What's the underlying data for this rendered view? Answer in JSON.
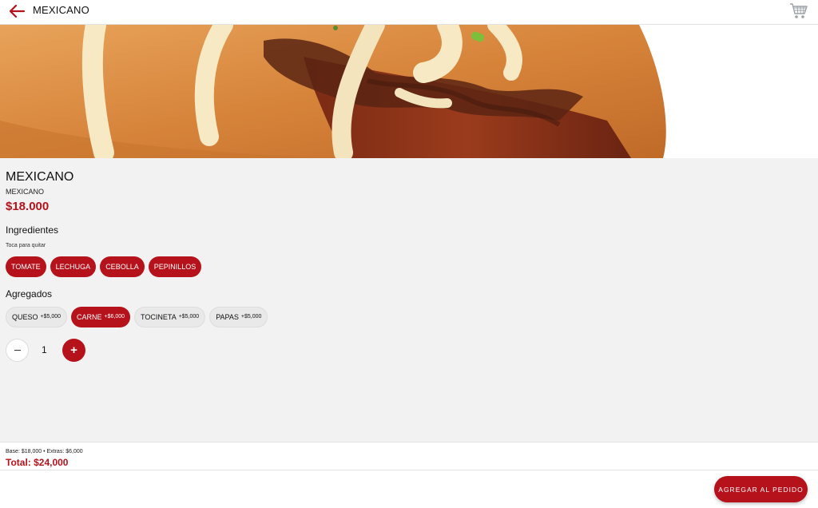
{
  "header": {
    "title": "MEXICANO",
    "back_icon": "arrow-left-icon",
    "cart_icon": "shopping-cart-icon"
  },
  "hero": {
    "image": "hot-dog-photo"
  },
  "product": {
    "name": "MEXICANO",
    "subtitle": "MEXICANO",
    "price": "$18.000"
  },
  "ingredients": {
    "title": "Ingredientes",
    "hint": "Toca para quitar",
    "items": [
      {
        "label": "TOMATE",
        "selected": true
      },
      {
        "label": "LECHUGA",
        "selected": true
      },
      {
        "label": "CEBOLLA",
        "selected": true
      },
      {
        "label": "PEPINILLOS",
        "selected": true
      }
    ]
  },
  "extras": {
    "title": "Agregados",
    "items": [
      {
        "label": "QUESO",
        "price": "+$5,000",
        "selected": false
      },
      {
        "label": "CARNE",
        "price": "+$6,000",
        "selected": true
      },
      {
        "label": "TOCINETA",
        "price": "+$5,000",
        "selected": false
      },
      {
        "label": "PAPAS",
        "price": "+$5,000",
        "selected": false
      }
    ]
  },
  "quantity": {
    "value": "1",
    "minus_icon": "minus-icon",
    "plus_label": "+"
  },
  "summary": {
    "line": "Base: $18,000  •  Extras: $6,000",
    "total": "Total: $24,000"
  },
  "footer": {
    "add_label": "AGREGAR AL PEDIDO"
  },
  "colors": {
    "accent": "#b5121b",
    "background": "#f2f2f2"
  }
}
